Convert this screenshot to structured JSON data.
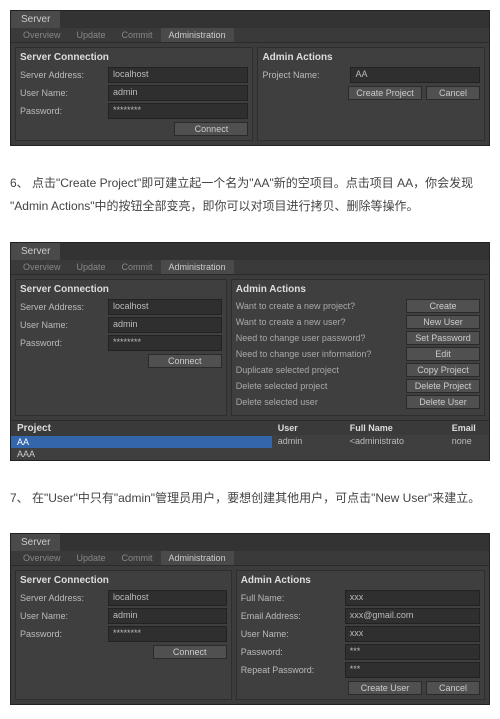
{
  "common": {
    "tab_server": "Server",
    "subtabs": {
      "overview": "Overview",
      "update": "Update",
      "commit": "Commit",
      "admin": "Administration"
    },
    "server_connection": {
      "title": "Server Connection",
      "address_label": "Server Address:",
      "address_value": "localhost",
      "user_label": "User Name:",
      "user_value": "admin",
      "pass_label": "Password:",
      "pass_value": "********",
      "connect_btn": "Connect"
    }
  },
  "panel1": {
    "admin_title": "Admin Actions",
    "project_name_label": "Project Name:",
    "project_name_value": "AA",
    "create_btn": "Create Project",
    "cancel_btn": "Cancel"
  },
  "text1": "6、 点击\"Create Project\"即可建立起一个名为\"AA\"新的空项目。点击项目 AA，你会发现 \"Admin Actions\"中的按钮全部变亮，即你可以对项目进行拷贝、删除等操作。",
  "panel2": {
    "admin_title": "Admin Actions",
    "rows": [
      {
        "label": "Want to create a new project?",
        "btn": "Create"
      },
      {
        "label": "Want to create a new user?",
        "btn": "New User"
      },
      {
        "label": "Need to change user password?",
        "btn": "Set Password"
      },
      {
        "label": "Need to change user information?",
        "btn": "Edit"
      },
      {
        "label": "Duplicate selected project",
        "btn": "Copy Project"
      },
      {
        "label": "Delete selected project",
        "btn": "Delete Project"
      },
      {
        "label": "Delete selected user",
        "btn": "Delete User"
      }
    ],
    "project_title": "Project",
    "projects": [
      "AA",
      "AAA"
    ],
    "user_cols": {
      "user": "User",
      "full": "Full Name",
      "email": "Email"
    },
    "user_row": {
      "user": "admin",
      "full": "<administrato",
      "email": "none"
    }
  },
  "text2": "7、 在\"User\"中只有\"admin\"管理员用户，要想创建其他用户，可点击\"New User\"来建立。",
  "panel3": {
    "admin_title": "Admin Actions",
    "fields": [
      {
        "label": "Full Name:",
        "value": "xxx"
      },
      {
        "label": "Email Address:",
        "value": "xxx@gmail.com"
      },
      {
        "label": "User Name:",
        "value": "xxx"
      },
      {
        "label": "Password:",
        "value": "***"
      },
      {
        "label": "Repeat Password:",
        "value": "***"
      }
    ],
    "create_btn": "Create User",
    "cancel_btn": "Cancel"
  }
}
